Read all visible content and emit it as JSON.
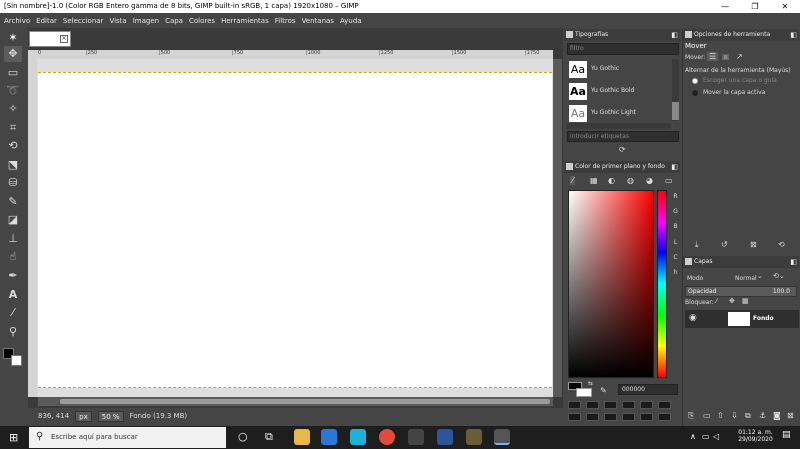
{
  "window": {
    "title": "[Sin nombre]-1.0 (Color RGB Entero gamma de 8 bits, GIMP built-in sRGB, 1 capa) 1920x1080 – GIMP",
    "min_icon": "—",
    "max_icon": "❐",
    "close_icon": "✕"
  },
  "menu": [
    "Archivo",
    "Editar",
    "Seleccionar",
    "Vista",
    "Imagen",
    "Capa",
    "Colores",
    "Herramientas",
    "Filtros",
    "Ventanas",
    "Ayuda"
  ],
  "ruler": {
    "h_ticks": [
      "|250",
      "|500",
      "|750",
      "|1000",
      "|1250",
      "|1500",
      "|1750"
    ],
    "zero": "0"
  },
  "status": {
    "coords": "836, 414",
    "unit": "px",
    "zoom": "50 %",
    "layer_info": "Fondo (19.3 MB)"
  },
  "fonts_panel": {
    "title": "Tipografías",
    "filter_placeholder": "filtro",
    "fonts": [
      {
        "preview": "Aa",
        "name": "Yu Gothic"
      },
      {
        "preview": "Aa",
        "name": "Yu Gothic Bold"
      },
      {
        "preview": "Aa",
        "name": "Yu Gothic Light"
      }
    ],
    "tags_placeholder": "introducir etiquetas"
  },
  "fgbg_panel": {
    "title": "Color de primer plano y fondo",
    "channels": [
      "R",
      "G",
      "B",
      "L",
      "C",
      "h"
    ],
    "hex_value": "000000"
  },
  "tool_options": {
    "title": "Opciones de herramienta",
    "tool_name": "Mover",
    "move_label": "Mover:",
    "toggle_label": "Alternar de la herramienta  (Mayús)",
    "opt1": "Escoger una capa o guía",
    "opt2": "Mover la capa activa"
  },
  "layers_panel": {
    "title": "Capas",
    "mode_label": "Modo",
    "mode_value": "Normal",
    "opacity_label": "Opacidad",
    "opacity_value": "100.0",
    "lock_label": "Bloquear:",
    "layer_name": "Fondo"
  },
  "taskbar": {
    "search_placeholder": "Escribe aquí para buscar",
    "time": "01:12 a. m.",
    "date": "29/09/2020"
  },
  "colors": {
    "bg": "#454545",
    "canvas": "#ffffff",
    "foreground": "#000000",
    "background": "#ffffff"
  }
}
